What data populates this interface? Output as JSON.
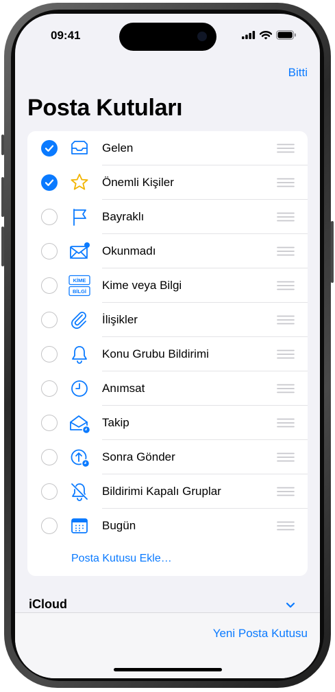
{
  "status": {
    "time": "09:41"
  },
  "nav": {
    "done_label": "Bitti",
    "title": "Posta Kutuları"
  },
  "mailboxes": [
    {
      "label": "Gelen",
      "checked": true,
      "icon": "inbox-icon"
    },
    {
      "label": "Önemli Kişiler",
      "checked": true,
      "icon": "star-icon"
    },
    {
      "label": "Bayraklı",
      "checked": false,
      "icon": "flag-icon"
    },
    {
      "label": "Okunmadı",
      "checked": false,
      "icon": "unread-envelope-icon"
    },
    {
      "label": "Kime veya Bilgi",
      "checked": false,
      "icon": "to-cc-icon",
      "icon_text": [
        "KİME",
        "BİLGİ"
      ]
    },
    {
      "label": "İlişikler",
      "checked": false,
      "icon": "paperclip-icon"
    },
    {
      "label": "Konu Grubu Bildirimi",
      "checked": false,
      "icon": "bell-icon"
    },
    {
      "label": "Anımsat",
      "checked": false,
      "icon": "clock-icon"
    },
    {
      "label": "Takip",
      "checked": false,
      "icon": "follow-up-envelope-icon"
    },
    {
      "label": "Sonra Gönder",
      "checked": false,
      "icon": "send-later-icon"
    },
    {
      "label": "Bildirimi Kapalı Gruplar",
      "checked": false,
      "icon": "bell-slash-icon"
    },
    {
      "label": "Bugün",
      "checked": false,
      "icon": "calendar-icon"
    }
  ],
  "add_mailbox_label": "Posta Kutusu Ekle…",
  "account": {
    "name": "iCloud"
  },
  "toolbar": {
    "new_mailbox_label": "Yeni Posta Kutusu"
  },
  "colors": {
    "accent": "#0a7aff",
    "background": "#f2f2f7",
    "card": "#ffffff"
  }
}
